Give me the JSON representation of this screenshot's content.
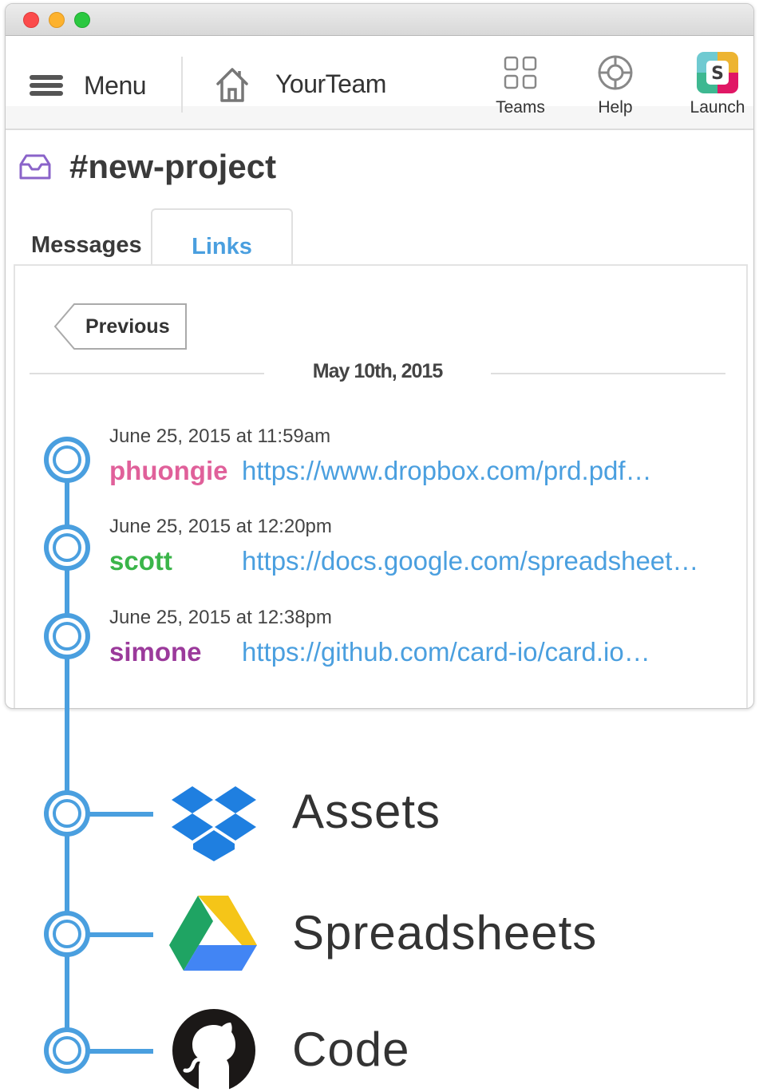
{
  "toolbar": {
    "menu_label": "Menu",
    "team_label": "YourTeam",
    "teams_label": "Teams",
    "help_label": "Help",
    "launch_label": "Launch"
  },
  "channel": {
    "name": "#new-project"
  },
  "tabs": [
    {
      "label": "Messages",
      "active": false
    },
    {
      "label": "Links",
      "active": true
    }
  ],
  "pagination": {
    "previous_label": "Previous"
  },
  "date_separator": "May 10th, 2015",
  "entries": [
    {
      "time": "June 25, 2015 at 11:59am",
      "user": "phuongie",
      "user_color": "#e0609a",
      "link": "https://www.dropbox.com/prd.pdf…"
    },
    {
      "time": "June 25, 2015 at 12:20pm",
      "user": "scott",
      "user_color": "#3bb54a",
      "link": "https://docs.google.com/spreadsheet…"
    },
    {
      "time": "June 25, 2015 at 12:38pm",
      "user": "simone",
      "user_color": "#9b3a9b",
      "link": "https://github.com/card-io/card.io…"
    }
  ],
  "services": [
    {
      "label": "Assets",
      "icon": "dropbox-icon"
    },
    {
      "label": "Spreadsheets",
      "icon": "google-drive-icon"
    },
    {
      "label": "Code",
      "icon": "github-icon"
    }
  ],
  "colors": {
    "accent": "#4a9fdf",
    "channel_icon": "#8a63c9"
  }
}
